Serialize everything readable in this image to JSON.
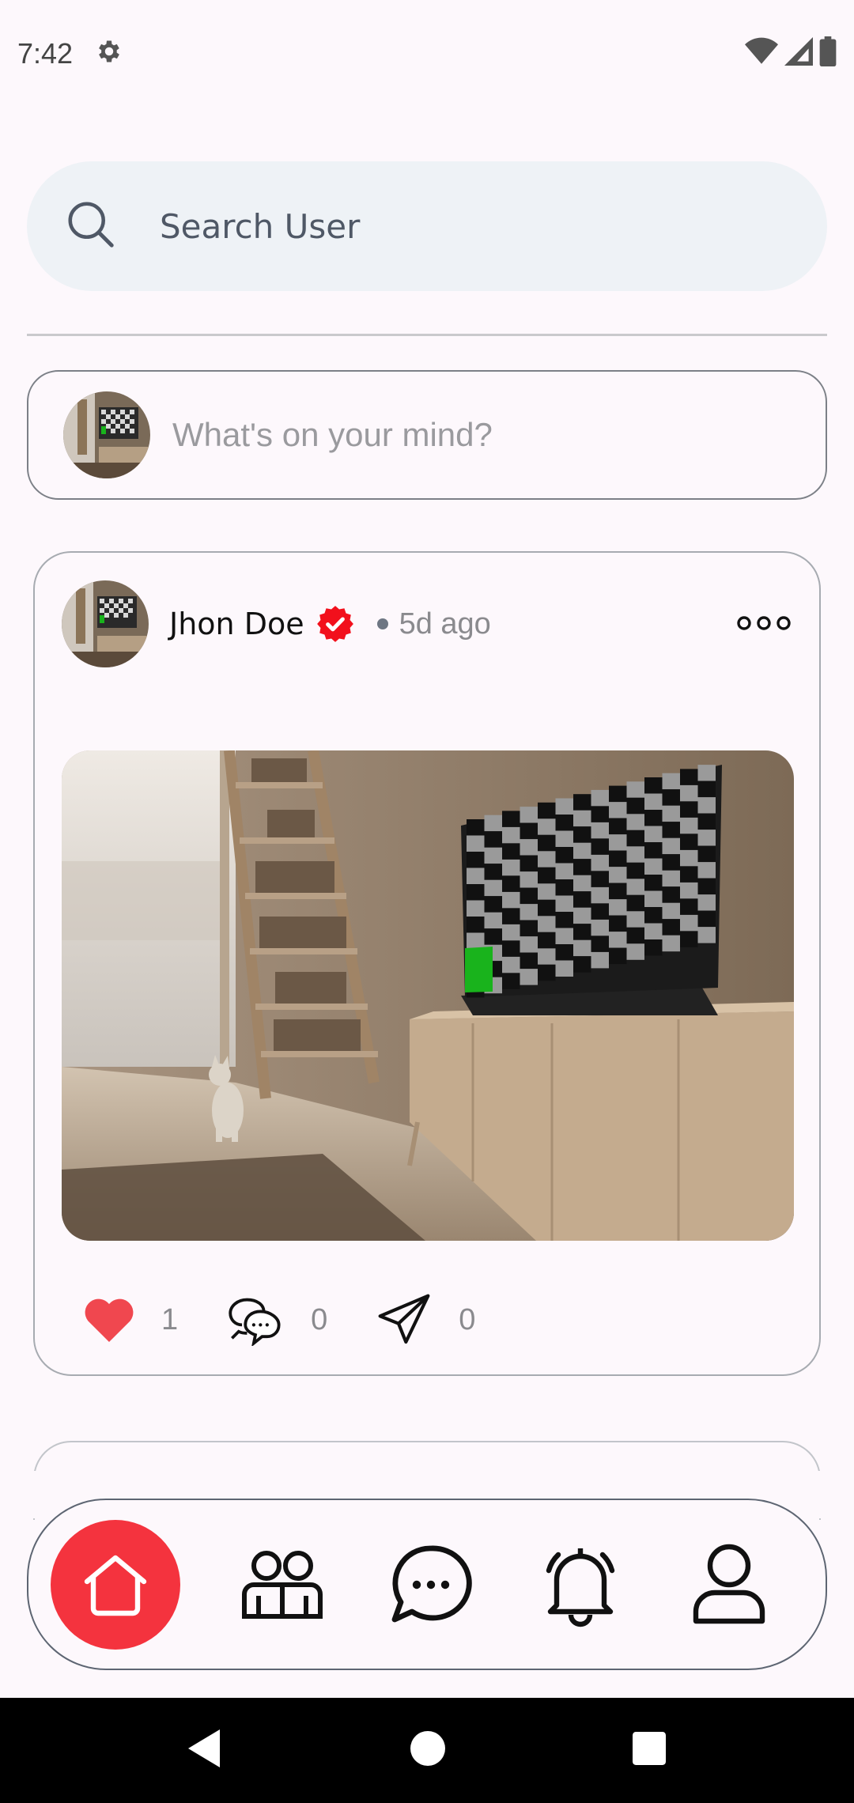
{
  "status_bar": {
    "time": "7:42",
    "icons": [
      "settings-icon",
      "wifi-icon",
      "signal-icon",
      "battery-icon"
    ]
  },
  "search": {
    "placeholder": "Search User",
    "icon": "search-icon"
  },
  "composer": {
    "placeholder": "What's on your mind?"
  },
  "post": {
    "author": "Jhon Doe",
    "verified": true,
    "time_ago": "5d ago",
    "likes": "1",
    "comments": "0",
    "shares": "0",
    "like_color": "#f0474f"
  },
  "bottom_nav": {
    "items": [
      "home-icon",
      "friends-icon",
      "chat-icon",
      "bell-icon",
      "profile-icon"
    ],
    "active": "home",
    "accent": "#f4333e"
  },
  "system_nav": [
    "back-icon",
    "home-circle-icon",
    "recents-icon"
  ]
}
